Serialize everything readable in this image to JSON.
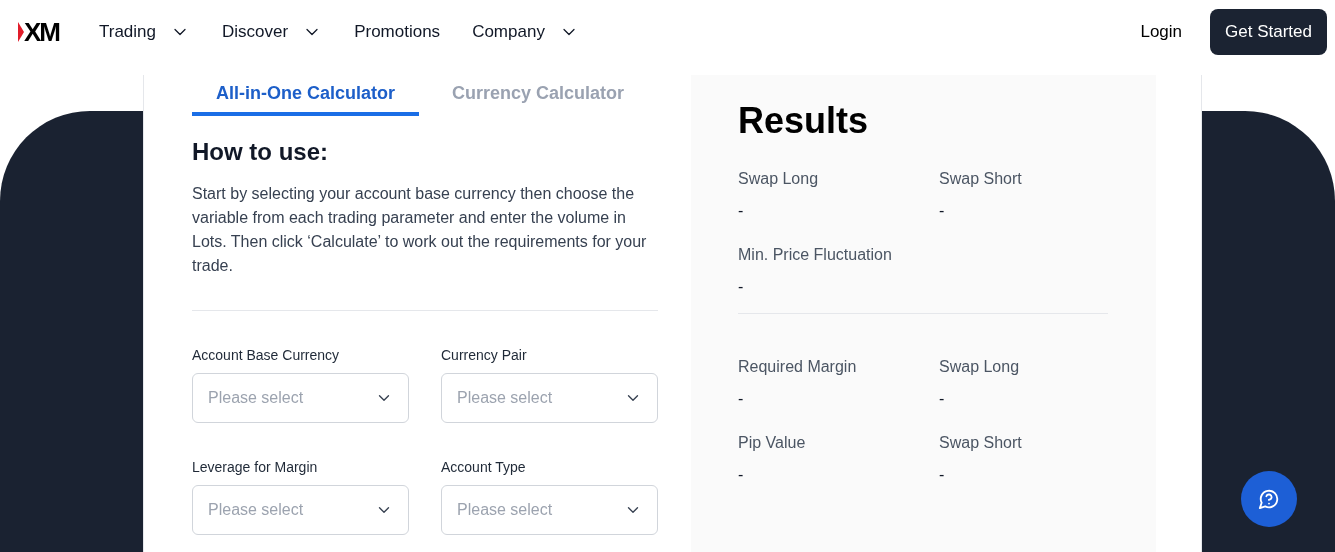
{
  "header": {
    "logo": "XM",
    "nav": [
      {
        "label": "Trading",
        "dropdown": true
      },
      {
        "label": "Discover",
        "dropdown": true
      },
      {
        "label": "Promotions",
        "dropdown": false
      },
      {
        "label": "Company",
        "dropdown": true
      }
    ],
    "login": "Login",
    "cta": "Get Started"
  },
  "tabs": [
    {
      "label": "All-in-One Calculator",
      "selected": true
    },
    {
      "label": "Currency Calculator",
      "selected": false
    }
  ],
  "how_to": {
    "title": "How to use:",
    "text": "Start by selecting your account base currency then choose the variable from each trading parameter and enter the volume in Lots. Then click ‘Calculate’ to work out the requirements for your trade."
  },
  "fields": [
    {
      "label": "Account Base Currency",
      "placeholder": "Please select"
    },
    {
      "label": "Currency Pair",
      "placeholder": "Please select"
    },
    {
      "label": "Leverage for Margin",
      "placeholder": "Please select"
    },
    {
      "label": "Account Type",
      "placeholder": "Please select"
    }
  ],
  "results": {
    "title": "Results",
    "sections": [
      {
        "items": [
          {
            "label": "Swap Long",
            "value": "-"
          },
          {
            "label": "Swap Short",
            "value": "-"
          },
          {
            "label": "Min. Price Fluctuation",
            "value": "-"
          }
        ]
      },
      {
        "items": [
          {
            "label": "Required Margin",
            "value": "-"
          },
          {
            "label": "Swap Long",
            "value": "-"
          },
          {
            "label": "Pip Value",
            "value": "-"
          },
          {
            "label": "Swap Short",
            "value": "-"
          }
        ]
      }
    ]
  }
}
